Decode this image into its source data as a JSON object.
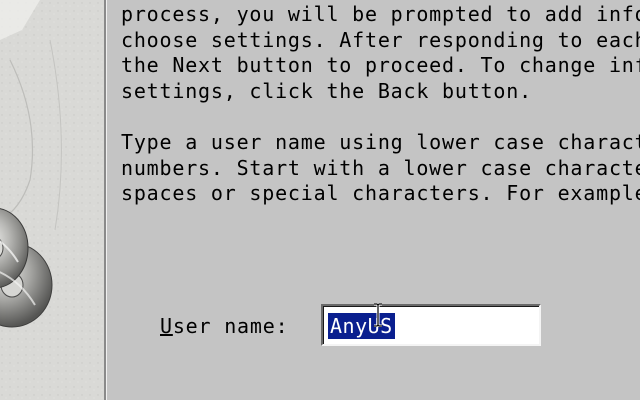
{
  "instructions": {
    "paragraph_1": "process, you will be prompted to add inform\nchoose settings. After responding to each p\nthe Next button to proceed. To change infor\nsettings, click the Back button.",
    "paragraph_2": "Type a user name using lower case characters\nnumbers. Start with a lower case character\nspaces or special characters. For example: "
  },
  "form": {
    "username_label_accel": "U",
    "username_label_rest": "ser name:",
    "username_value": "AnyUS"
  },
  "icons": {
    "side_art": "cd-discs-art",
    "cursor": "ibeam-cursor-icon"
  },
  "colors": {
    "background": "#c4c4c4",
    "selection": "#0a1f8f",
    "selection_text": "#ffffff"
  }
}
